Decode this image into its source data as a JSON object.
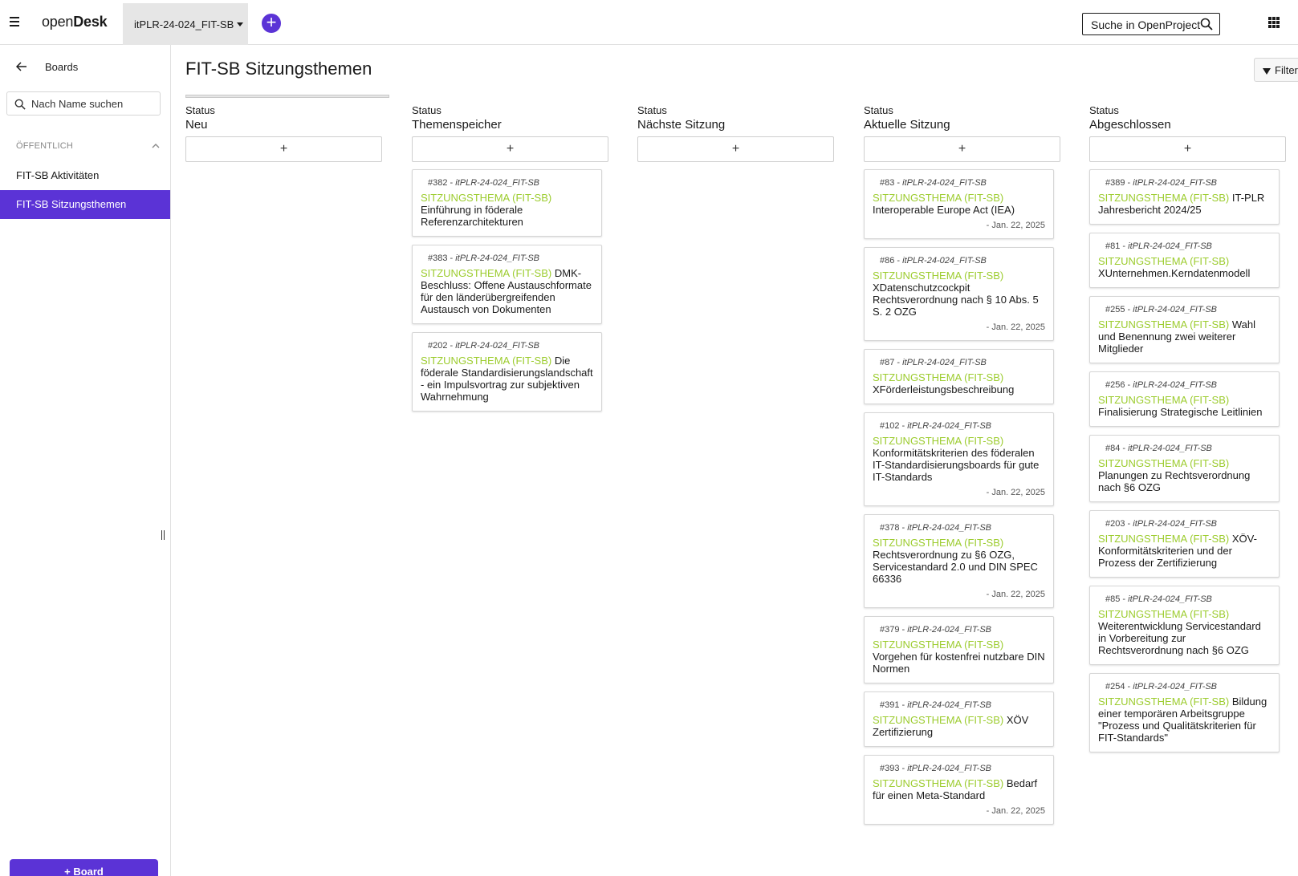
{
  "header": {
    "logo_part1": "open",
    "logo_part2": "Desk",
    "project_name": "itPLR-24-024_FIT-SB",
    "search_placeholder": "Suche in OpenProject"
  },
  "sidebar": {
    "back_label": "Boards",
    "search_placeholder": "Nach Name suchen",
    "section_label": "ÖFFENTLICH",
    "items": [
      {
        "label": "FIT-SB Aktivitäten",
        "active": false
      },
      {
        "label": "FIT-SB Sitzungsthemen",
        "active": true
      }
    ],
    "board_button_label": "+ Board"
  },
  "main": {
    "title": "FIT-SB Sitzungsthemen",
    "filter_label": "Filter",
    "add_symbol": "+",
    "columns": [
      {
        "label": "Status",
        "name": "Neu",
        "cards": []
      },
      {
        "label": "Status",
        "name": "Themenspeicher",
        "cards": [
          {
            "id": "#382",
            "project": "itPLR-24-024_FIT-SB",
            "type": "SITZUNGSTHEMA (FIT-SB)",
            "title": "Einführung in föderale Referenzarchitekturen",
            "date": ""
          },
          {
            "id": "#383",
            "project": "itPLR-24-024_FIT-SB",
            "type": "SITZUNGSTHEMA (FIT-SB)",
            "title": "DMK-Beschluss: Offene Austauschformate für den länderübergreifenden Austausch von Dokumenten",
            "date": ""
          },
          {
            "id": "#202",
            "project": "itPLR-24-024_FIT-SB",
            "type": "SITZUNGSTHEMA (FIT-SB)",
            "title": "Die föderale Standardisierungslandschaft - ein Impulsvortrag zur subjektiven Wahrnehmung",
            "date": ""
          }
        ]
      },
      {
        "label": "Status",
        "name": "Nächste Sitzung",
        "cards": []
      },
      {
        "label": "Status",
        "name": "Aktuelle Sitzung",
        "cards": [
          {
            "id": "#83",
            "project": "itPLR-24-024_FIT-SB",
            "type": "SITZUNGSTHEMA (FIT-SB)",
            "title": "Interoperable Europe Act (IEA)",
            "date": "- Jan. 22, 2025"
          },
          {
            "id": "#86",
            "project": "itPLR-24-024_FIT-SB",
            "type": "SITZUNGSTHEMA (FIT-SB)",
            "title": "XDatenschutzcockpit Rechtsverordnung nach § 10 Abs. 5 S. 2 OZG",
            "date": "- Jan. 22, 2025"
          },
          {
            "id": "#87",
            "project": "itPLR-24-024_FIT-SB",
            "type": "SITZUNGSTHEMA (FIT-SB)",
            "title": "XFörderleistungsbeschreibung",
            "date": ""
          },
          {
            "id": "#102",
            "project": "itPLR-24-024_FIT-SB",
            "type": "SITZUNGSTHEMA (FIT-SB)",
            "title": "Konformitätskriterien des föderalen IT-Standardisierungsboards für gute IT-Standards",
            "date": "- Jan. 22, 2025"
          },
          {
            "id": "#378",
            "project": "itPLR-24-024_FIT-SB",
            "type": "SITZUNGSTHEMA (FIT-SB)",
            "title": "Rechtsverordnung zu §6 OZG, Servicestandard 2.0 und DIN SPEC 66336",
            "date": "- Jan. 22, 2025"
          },
          {
            "id": "#379",
            "project": "itPLR-24-024_FIT-SB",
            "type": "SITZUNGSTHEMA (FIT-SB)",
            "title": "Vorgehen für kostenfrei nutzbare DIN Normen",
            "date": ""
          },
          {
            "id": "#391",
            "project": "itPLR-24-024_FIT-SB",
            "type": "SITZUNGSTHEMA (FIT-SB)",
            "title": "XÖV Zertifizierung",
            "date": ""
          },
          {
            "id": "#393",
            "project": "itPLR-24-024_FIT-SB",
            "type": "SITZUNGSTHEMA (FIT-SB)",
            "title": "Bedarf für einen Meta-Standard",
            "date": "- Jan. 22, 2025"
          }
        ]
      },
      {
        "label": "Status",
        "name": "Abgeschlossen",
        "cards": [
          {
            "id": "#389",
            "project": "itPLR-24-024_FIT-SB",
            "type": "SITZUNGSTHEMA (FIT-SB)",
            "title": "IT-PLR Jahresbericht 2024/25",
            "date": ""
          },
          {
            "id": "#81",
            "project": "itPLR-24-024_FIT-SB",
            "type": "SITZUNGSTHEMA (FIT-SB)",
            "title": "XUnternehmen.Kerndatenmodell",
            "date": ""
          },
          {
            "id": "#255",
            "project": "itPLR-24-024_FIT-SB",
            "type": "SITZUNGSTHEMA (FIT-SB)",
            "title": "Wahl und Benennung zwei weiterer Mitglieder",
            "date": ""
          },
          {
            "id": "#256",
            "project": "itPLR-24-024_FIT-SB",
            "type": "SITZUNGSTHEMA (FIT-SB)",
            "title": "Finalisierung Strategische Leitlinien",
            "date": ""
          },
          {
            "id": "#84",
            "project": "itPLR-24-024_FIT-SB",
            "type": "SITZUNGSTHEMA (FIT-SB)",
            "title": "Planungen zu Rechtsverordnung nach §6 OZG",
            "date": ""
          },
          {
            "id": "#203",
            "project": "itPLR-24-024_FIT-SB",
            "type": "SITZUNGSTHEMA (FIT-SB)",
            "title": "XÖV-Konformitätskriterien und der Prozess der Zertifizierung",
            "date": ""
          },
          {
            "id": "#85",
            "project": "itPLR-24-024_FIT-SB",
            "type": "SITZUNGSTHEMA (FIT-SB)",
            "title": "Weiterentwicklung Servicestandard in Vorbereitung zur Rechtsverordnung nach §6 OZG",
            "date": ""
          },
          {
            "id": "#254",
            "project": "itPLR-24-024_FIT-SB",
            "type": "SITZUNGSTHEMA (FIT-SB)",
            "title": "Bildung einer temporären Arbeitsgruppe \"Prozess und Qualitätskriterien für FIT-Standards\"",
            "date": ""
          }
        ]
      }
    ]
  },
  "colors": {
    "accent": "#5b33d6",
    "type_label": "#9ccc2e"
  }
}
